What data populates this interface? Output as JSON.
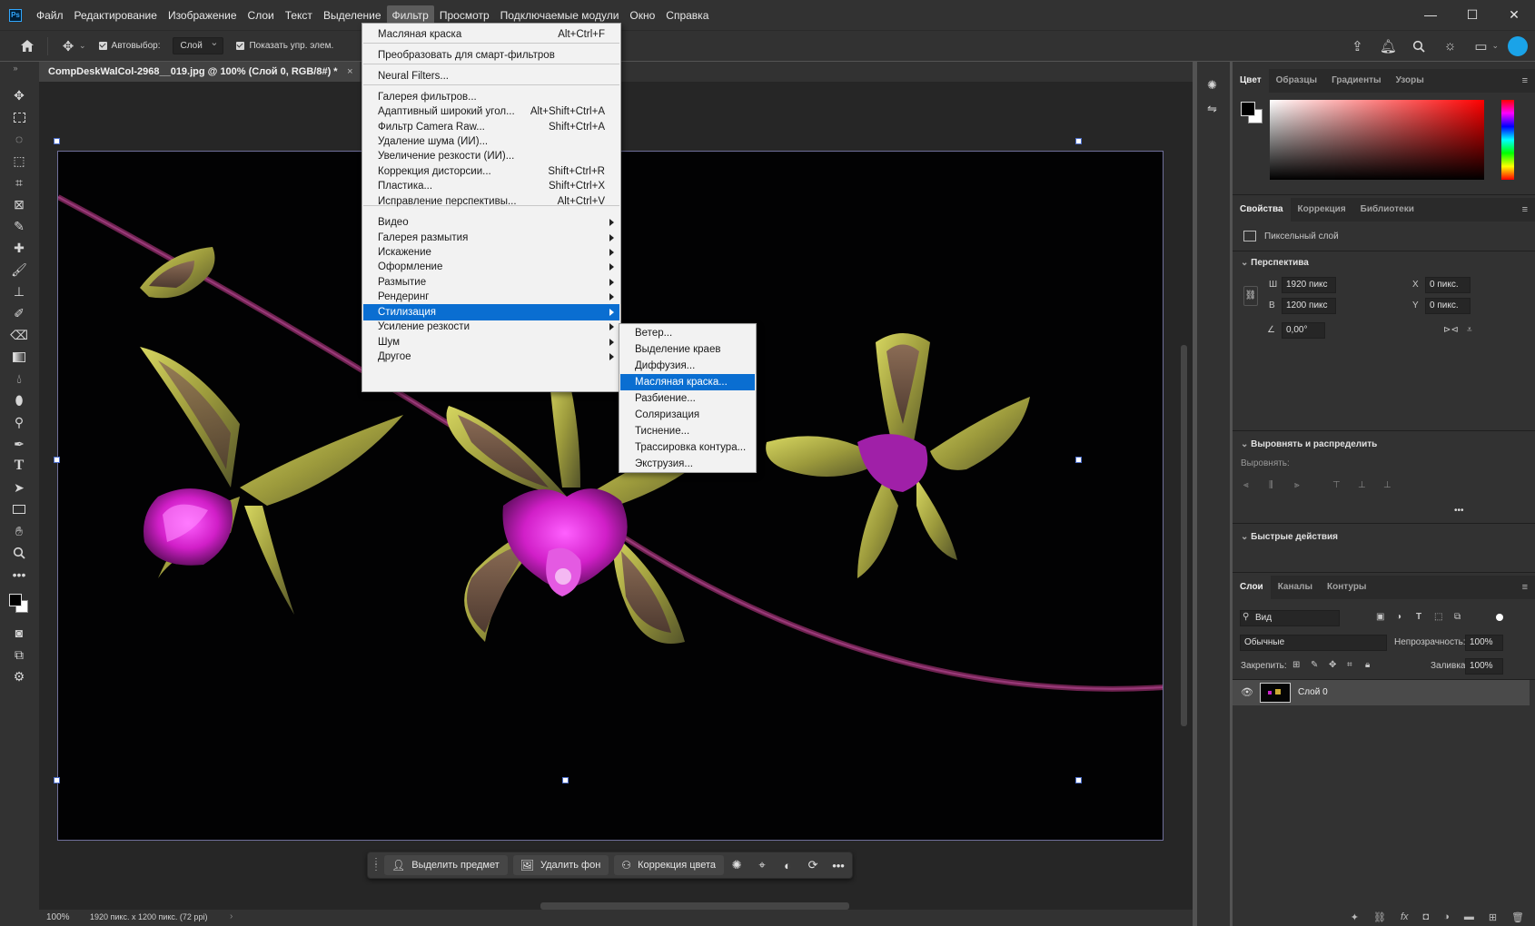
{
  "menubar": {
    "logo": "Ps",
    "items": [
      "Файл",
      "Редактирование",
      "Изображение",
      "Слои",
      "Текст",
      "Выделение",
      "Фильтр",
      "Просмотр",
      "Подключаемые модули",
      "Окно",
      "Справка"
    ],
    "active_index": 6,
    "window_controls": [
      "—",
      "☐",
      "✕"
    ]
  },
  "options": {
    "autoselect_label": "Автовыбор:",
    "autoselect_value": "Слой",
    "show_controls_label": "Показать упр. элем."
  },
  "document": {
    "tab_title": "CompDeskWalCol-2968__019.jpg @ 100% (Слой 0, RGB/8#) *",
    "tab_close": "×"
  },
  "filter_menu": {
    "items": [
      {
        "label": "Масляная краска",
        "shortcut": "Alt+Ctrl+F"
      },
      {
        "label": "Преобразовать для смарт-фильтров",
        "shortcut": ""
      },
      {
        "label": "Neural Filters...",
        "shortcut": ""
      },
      {
        "label": "Галерея фильтров...",
        "shortcut": ""
      },
      {
        "label": "Адаптивный широкий угол...",
        "shortcut": "Alt+Shift+Ctrl+A"
      },
      {
        "label": "Фильтр Camera Raw...",
        "shortcut": "Shift+Ctrl+A"
      },
      {
        "label": "Удаление шума (ИИ)...",
        "shortcut": ""
      },
      {
        "label": "Увеличение резкости (ИИ)...",
        "shortcut": ""
      },
      {
        "label": "Коррекция дисторсии...",
        "shortcut": "Shift+Ctrl+R"
      },
      {
        "label": "Пластика...",
        "shortcut": "Shift+Ctrl+X"
      },
      {
        "label": "Исправление перспективы...",
        "shortcut": "Alt+Ctrl+V"
      },
      {
        "label": "Видео",
        "shortcut": ""
      },
      {
        "label": "Галерея размытия",
        "shortcut": ""
      },
      {
        "label": "Искажение",
        "shortcut": ""
      },
      {
        "label": "Оформление",
        "shortcut": ""
      },
      {
        "label": "Размытие",
        "shortcut": ""
      },
      {
        "label": "Рендеринг",
        "shortcut": ""
      },
      {
        "label": "Стилизация",
        "shortcut": ""
      },
      {
        "label": "Усиление резкости",
        "shortcut": ""
      },
      {
        "label": "Шум",
        "shortcut": ""
      },
      {
        "label": "Другое",
        "shortcut": ""
      }
    ],
    "highlighted": "Стилизация"
  },
  "stylize_submenu": {
    "items": [
      "Ветер...",
      "Выделение краев",
      "Диффузия...",
      "Масляная краска...",
      "Разбиение...",
      "Соляризация",
      "Тиснение...",
      "Трассировка контура...",
      "Экструзия..."
    ],
    "highlighted": "Масляная краска..."
  },
  "context_bar": {
    "select_subject": "Выделить предмет",
    "remove_bg": "Удалить фон",
    "color_correction": "Коррекция цвета"
  },
  "status": {
    "zoom": "100%",
    "info": "1920 пикс. x 1200 пикс. (72 ppi)"
  },
  "color_panel": {
    "tabs": [
      "Цвет",
      "Образцы",
      "Градиенты",
      "Узоры"
    ],
    "active": "Цвет",
    "hue_color": "#ff0000"
  },
  "properties_panel": {
    "tabs": [
      "Свойства",
      "Коррекция",
      "Библиотеки"
    ],
    "active": "Свойства",
    "layer_type": "Пиксельный слой",
    "transform_title": "Перспектива",
    "w_label": "Ш",
    "w_value": "1920 пикс",
    "h_label": "В",
    "h_value": "1200 пикс",
    "x_label": "X",
    "x_value": "0 пикс.",
    "y_label": "Y",
    "y_value": "0 пикс.",
    "angle_value": "0,00°",
    "align_title": "Выровнять и распределить",
    "align_label": "Выровнять:",
    "more": "•••",
    "quick_actions_title": "Быстрые действия"
  },
  "layers_panel": {
    "tabs": [
      "Слои",
      "Каналы",
      "Контуры"
    ],
    "active": "Слои",
    "filter_kind": "Вид",
    "blend_mode": "Обычные",
    "opacity_label": "Непрозрачность:",
    "opacity_value": "100%",
    "lock_label": "Закрепить:",
    "fill_label": "Заливка:",
    "fill_value": "100%",
    "layers": [
      {
        "name": "Слой 0",
        "visible": true
      }
    ]
  }
}
